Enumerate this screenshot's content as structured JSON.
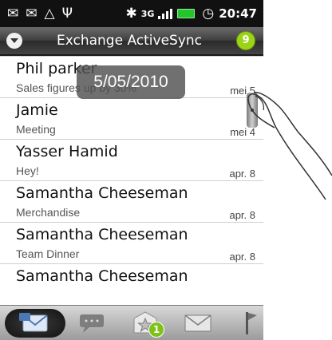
{
  "status_bar": {
    "icons": [
      "mail-notification-icon",
      "envelope-icon",
      "warning-icon",
      "usb-icon",
      "bluetooth-icon",
      "3g-icon",
      "signal-icon",
      "battery-icon",
      "alarm-icon"
    ],
    "network": "3G",
    "time": "20:47"
  },
  "header": {
    "title": "Exchange ActiveSync",
    "unread_count": "9",
    "count_color": "#9bd417"
  },
  "date_popup": "5/05/2010",
  "messages": [
    {
      "sender": "Phil parker",
      "subject": "Sales figures up by 30%",
      "date": "mei 5"
    },
    {
      "sender": "Jamie",
      "subject": "Meeting",
      "date": "mei 4"
    },
    {
      "sender": "Yasser Hamid",
      "subject": "Hey!",
      "date": "apr. 8"
    },
    {
      "sender": "Samantha Cheeseman",
      "subject": "Merchandise",
      "date": "apr. 8"
    },
    {
      "sender": "Samantha Cheeseman",
      "subject": "Team Dinner",
      "date": "apr. 8"
    },
    {
      "sender": "Samantha Cheeseman",
      "subject": "",
      "date": ""
    }
  ],
  "bottom_tabs": [
    {
      "icon": "inbox-icon",
      "active": true
    },
    {
      "icon": "conversations-icon",
      "active": false
    },
    {
      "icon": "favorites-icon",
      "badge": "1",
      "active": false
    },
    {
      "icon": "unread-icon",
      "active": false
    },
    {
      "icon": "flagged-icon",
      "active": false
    }
  ]
}
